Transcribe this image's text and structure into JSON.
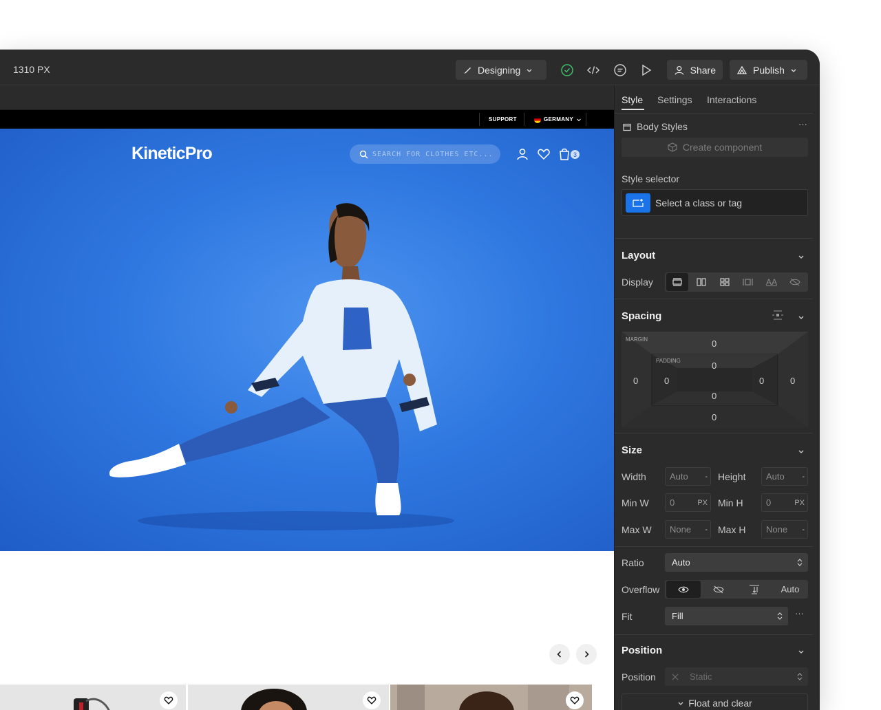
{
  "toolbar": {
    "breakpoint": "1310 PX",
    "mode": "Designing",
    "share": "Share",
    "publish": "Publish"
  },
  "site": {
    "support": "SUPPORT",
    "region": "GERMANY",
    "logo": "KineticPro",
    "search_placeholder": "SEARCH FOR CLOTHES ETC...",
    "cart_count": "3"
  },
  "panel": {
    "tabs": [
      "Style",
      "Settings",
      "Interactions"
    ],
    "element": "Body Styles",
    "more": "···",
    "create_component": "Create component",
    "style_selector_label": "Style selector",
    "style_selector_placeholder": "Select a class or tag",
    "layout": {
      "title": "Layout",
      "display_label": "Display",
      "aa": "AA"
    },
    "spacing": {
      "title": "Spacing",
      "margin_label": "MARGIN",
      "padding_label": "PADDING",
      "margin": {
        "top": "0",
        "right": "0",
        "bottom": "0",
        "left": "0"
      },
      "padding": {
        "top": "0",
        "right": "0",
        "bottom": "0",
        "left": "0"
      }
    },
    "size": {
      "title": "Size",
      "width_label": "Width",
      "width_value": "Auto",
      "width_unit": "-",
      "height_label": "Height",
      "height_value": "Auto",
      "height_unit": "-",
      "minw_label": "Min W",
      "minw_value": "0",
      "minw_unit": "PX",
      "minh_label": "Min H",
      "minh_value": "0",
      "minh_unit": "PX",
      "maxw_label": "Max W",
      "maxw_value": "None",
      "maxw_unit": "-",
      "maxh_label": "Max H",
      "maxh_value": "None",
      "maxh_unit": "-",
      "ratio_label": "Ratio",
      "ratio_value": "Auto",
      "overflow_label": "Overflow",
      "overflow_auto": "Auto",
      "fit_label": "Fit",
      "fit_value": "Fill"
    },
    "position": {
      "title": "Position",
      "position_label": "Position",
      "position_value": "Static",
      "float_clear": "Float and clear"
    }
  },
  "colors": {
    "app_bg": "#2b2b2b",
    "accent_blue": "#1a73e8",
    "hero_blue": "#2f78e0",
    "status_green": "#3fbf6a"
  }
}
